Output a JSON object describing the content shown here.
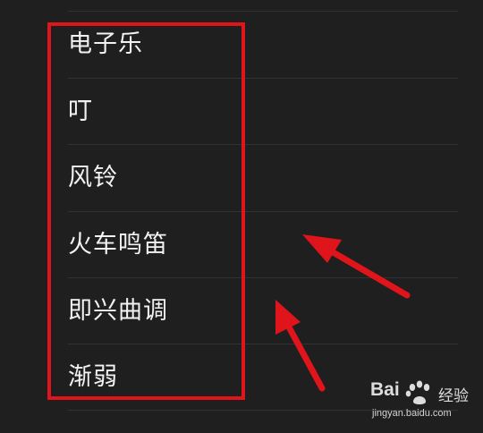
{
  "ringtone_list": {
    "items": [
      {
        "label": "电子乐"
      },
      {
        "label": "叮"
      },
      {
        "label": "风铃"
      },
      {
        "label": "火车鸣笛"
      },
      {
        "label": "即兴曲调"
      },
      {
        "label": "渐弱"
      }
    ]
  },
  "watermark": {
    "logo_text": "Bai",
    "logo_suffix": "经验",
    "url": "jingyan.baidu.com"
  },
  "colors": {
    "background": "#1f1f1f",
    "text": "#f2f2f2",
    "divider": "#323232",
    "annotation": "#e0141b"
  }
}
